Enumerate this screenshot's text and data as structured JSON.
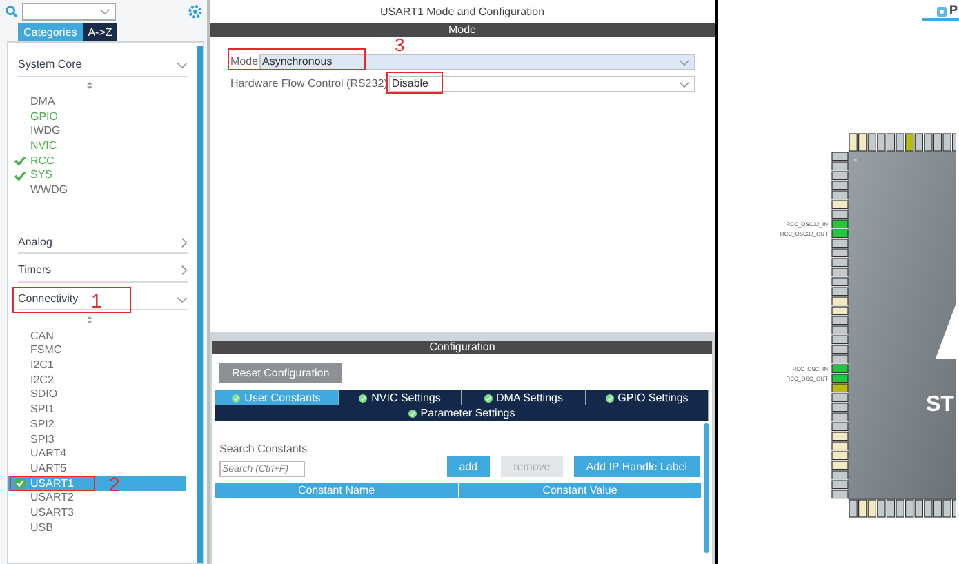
{
  "left_panel": {
    "tabs": [
      {
        "label": "Categories",
        "selected": true
      },
      {
        "label": "A->Z",
        "selected": false
      }
    ],
    "categories": [
      {
        "label": "System Core",
        "expanded": true,
        "items": [
          {
            "label": "DMA",
            "configured": false,
            "checked": false,
            "selected": false
          },
          {
            "label": "GPIO",
            "configured": true,
            "checked": false,
            "selected": false
          },
          {
            "label": "IWDG",
            "configured": false,
            "checked": false,
            "selected": false
          },
          {
            "label": "NVIC",
            "configured": true,
            "checked": false,
            "selected": false
          },
          {
            "label": "RCC",
            "configured": true,
            "checked": true,
            "selected": false
          },
          {
            "label": "SYS",
            "configured": true,
            "checked": true,
            "selected": false
          },
          {
            "label": "WWDG",
            "configured": false,
            "checked": false,
            "selected": false
          }
        ]
      },
      {
        "label": "Analog",
        "expanded": false
      },
      {
        "label": "Timers",
        "expanded": false
      },
      {
        "label": "Connectivity",
        "expanded": true,
        "items": [
          {
            "label": "CAN",
            "configured": false,
            "checked": false,
            "selected": false
          },
          {
            "label": "FSMC",
            "configured": false,
            "checked": false,
            "selected": false
          },
          {
            "label": "I2C1",
            "configured": false,
            "checked": false,
            "selected": false
          },
          {
            "label": "I2C2",
            "configured": false,
            "checked": false,
            "selected": false
          },
          {
            "label": "SDIO",
            "configured": false,
            "checked": false,
            "selected": false
          },
          {
            "label": "SPI1",
            "configured": false,
            "checked": false,
            "selected": false
          },
          {
            "label": "SPI2",
            "configured": false,
            "checked": false,
            "selected": false
          },
          {
            "label": "SPI3",
            "configured": false,
            "checked": false,
            "selected": false
          },
          {
            "label": "UART4",
            "configured": false,
            "checked": false,
            "selected": false
          },
          {
            "label": "UART5",
            "configured": false,
            "checked": false,
            "selected": false
          },
          {
            "label": "USART1",
            "configured": true,
            "checked": true,
            "selected": true
          },
          {
            "label": "USART2",
            "configured": false,
            "checked": false,
            "selected": false
          },
          {
            "label": "USART3",
            "configured": false,
            "checked": false,
            "selected": false
          },
          {
            "label": "USB",
            "configured": false,
            "checked": false,
            "selected": false
          }
        ]
      }
    ]
  },
  "mode_panel": {
    "title": "USART1 Mode and Configuration",
    "mode_header": "Mode",
    "fields": [
      {
        "label": "Mode",
        "value": "Asynchronous",
        "focused": true
      },
      {
        "label": "Hardware Flow Control (RS232)",
        "value": "Disable",
        "focused": false
      }
    ],
    "config_header": "Configuration",
    "reset_button": "Reset Configuration",
    "tab_rows": [
      {
        "tabs": [
          {
            "label": "User Constants",
            "selected": true
          },
          {
            "label": "NVIC Settings",
            "selected": false
          },
          {
            "label": "DMA Settings",
            "selected": false
          },
          {
            "label": "GPIO Settings",
            "selected": false
          }
        ]
      },
      {
        "tabs": [
          {
            "label": "Parameter Settings",
            "selected": false
          }
        ]
      }
    ],
    "search_label": "Search Constants",
    "search": {
      "placeholder": "Search (Ctrl+F)"
    },
    "buttons": [
      {
        "label": "add",
        "disabled": false
      },
      {
        "label": "remove",
        "disabled": true
      },
      {
        "label": "Add IP Handle Label",
        "disabled": false
      }
    ],
    "table": {
      "columns": [
        "Constant Name",
        "Constant Value"
      ]
    }
  },
  "pinout_view": {
    "tab": {
      "label": "P"
    },
    "logo": "ST",
    "top_pins": [
      {
        "color": "#f3e9c2"
      },
      {
        "color": "#f3e9c2"
      },
      {
        "color": "#c3cacd"
      },
      {
        "color": "#c3cacd"
      },
      {
        "color": "#c3cacd"
      },
      {
        "color": "#c3cacd"
      },
      {
        "color": "#b8bb10"
      },
      {
        "color": "#c3cacd"
      },
      {
        "color": "#c3cacd"
      },
      {
        "color": "#c3cacd"
      },
      {
        "color": "#c3cacd"
      },
      {
        "color": "#c3cacd"
      }
    ],
    "left_pins": [
      {
        "color": "#c3cacd"
      },
      {
        "color": "#c3cacd"
      },
      {
        "color": "#c3cacd"
      },
      {
        "color": "#c3cacd"
      },
      {
        "color": "#c3cacd"
      },
      {
        "color": "#f3e9c2"
      },
      {
        "color": "#c3cacd"
      },
      {
        "color": "#22c440",
        "signal": "RCC_OSC32_IN"
      },
      {
        "color": "#22c440",
        "signal": "RCC_OSC32_OUT"
      },
      {
        "color": "#c3cacd"
      },
      {
        "color": "#c3cacd"
      },
      {
        "color": "#c3cacd"
      },
      {
        "color": "#c3cacd"
      },
      {
        "color": "#c3cacd"
      },
      {
        "color": "#c3cacd"
      },
      {
        "color": "#f3e9c2"
      },
      {
        "color": "#f3e9c2"
      },
      {
        "color": "#c3cacd"
      },
      {
        "color": "#c3cacd"
      },
      {
        "color": "#c3cacd"
      },
      {
        "color": "#c3cacd"
      },
      {
        "color": "#c3cacd"
      },
      {
        "color": "#22c440",
        "signal": "RCC_OSC_IN"
      },
      {
        "color": "#22c440",
        "signal": "RCC_OSC_OUT"
      },
      {
        "color": "#b8bb10"
      },
      {
        "color": "#c3cacd"
      },
      {
        "color": "#c3cacd"
      },
      {
        "color": "#c3cacd"
      },
      {
        "color": "#c3cacd"
      },
      {
        "color": "#f3e9c2"
      },
      {
        "color": "#f3e9c2"
      },
      {
        "color": "#f3e9c2"
      },
      {
        "color": "#f3e9c2"
      },
      {
        "color": "#c3cacd"
      },
      {
        "color": "#c3cacd"
      },
      {
        "color": "#c3cacd"
      }
    ],
    "bottom_pins": [
      {
        "color": "#c3cacd"
      },
      {
        "color": "#f3e9c2"
      },
      {
        "color": "#f3e9c2"
      },
      {
        "color": "#c3cacd"
      },
      {
        "color": "#c3cacd"
      },
      {
        "color": "#c3cacd"
      },
      {
        "color": "#c3cacd"
      },
      {
        "color": "#c3cacd"
      },
      {
        "color": "#c3cacd"
      },
      {
        "color": "#c3cacd"
      },
      {
        "color": "#c3cacd"
      },
      {
        "color": "#c3cacd"
      }
    ]
  },
  "annotations": [
    {
      "kind": "numbered",
      "number": "1"
    },
    {
      "kind": "numbered",
      "number": "2"
    },
    {
      "kind": "numbered",
      "number": "3"
    },
    {
      "kind": "plain"
    }
  ]
}
